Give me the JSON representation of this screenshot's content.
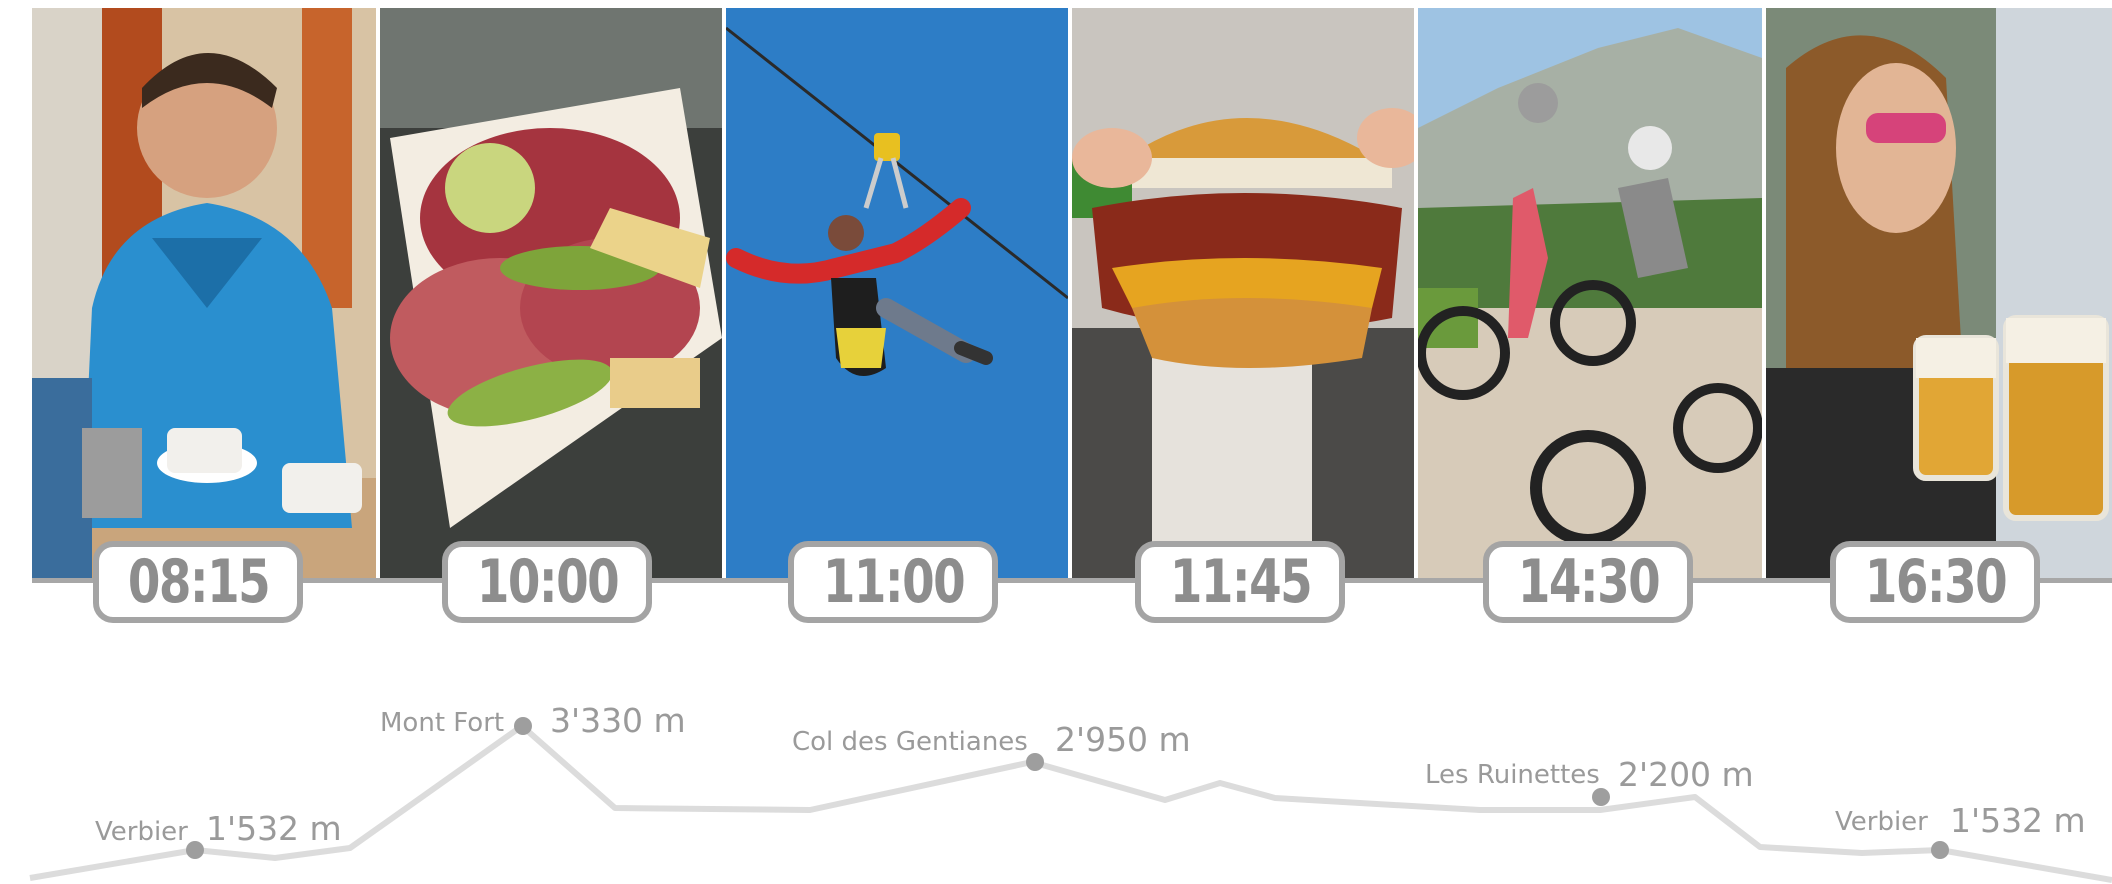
{
  "photos": [
    {
      "icon": "smiling-man-coffee-photo"
    },
    {
      "icon": "charcuterie-platter-photo"
    },
    {
      "icon": "zipline-rider-photo"
    },
    {
      "icon": "bacon-burger-photo"
    },
    {
      "icon": "mountain-scooter-riders-photo"
    },
    {
      "icon": "woman-with-beers-photo"
    }
  ],
  "times": [
    "08:15",
    "10:00",
    "11:00",
    "11:45",
    "14:30",
    "16:30"
  ],
  "stops": [
    {
      "name": "Verbier",
      "altitude": "1'532 m"
    },
    {
      "name": "Mont Fort",
      "altitude": "3'330 m"
    },
    {
      "name": "Col des Gentianes",
      "altitude": "2'950 m"
    },
    {
      "name": "Les Ruinettes",
      "altitude": "2'200 m"
    },
    {
      "name": "Verbier",
      "altitude": "1'532 m"
    }
  ],
  "colors": {
    "line": "#dcdcdc",
    "marker": "#9e9e9e",
    "badge_border": "#a4a4a4",
    "text": "#9a9a9a"
  }
}
